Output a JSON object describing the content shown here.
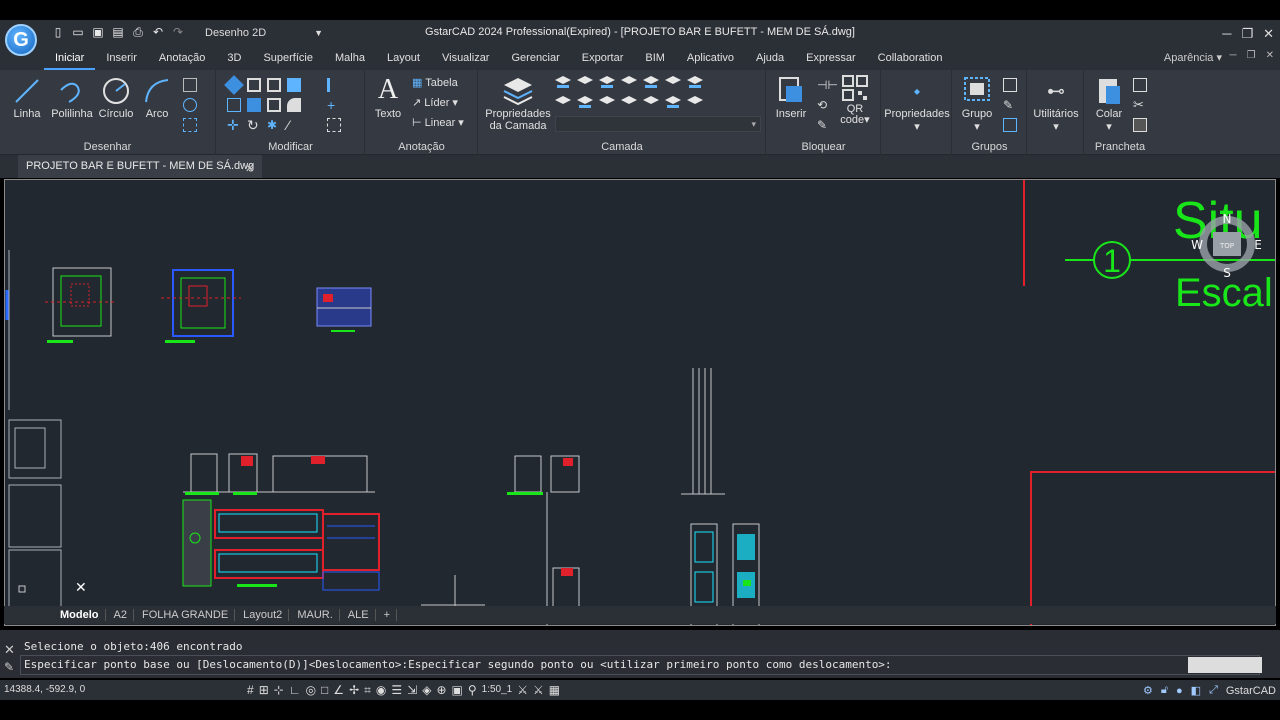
{
  "app": {
    "title": "GstarCAD 2024 Professional(Expired) - [PROJETO BAR E BUFETT - MEM DE SÁ.dwg]",
    "workspace": "Desenho 2D",
    "logo_letter": "G",
    "brand": "GstarCAD"
  },
  "menu": {
    "items": [
      "Iniciar",
      "Inserir",
      "Anotação",
      "3D",
      "Superfície",
      "Malha",
      "Layout",
      "Visualizar",
      "Gerenciar",
      "Exportar",
      "BIM",
      "Aplicativo",
      "Ajuda",
      "Expressar",
      "Collaboration"
    ],
    "active": "Iniciar",
    "aparencia": "Aparência"
  },
  "ribbon": {
    "desenhar": {
      "title": "Desenhar",
      "linha": "Linha",
      "polilinha": "Polilinha",
      "circulo": "Círculo",
      "arco": "Arco"
    },
    "modificar": {
      "title": "Modificar"
    },
    "anotacao": {
      "title": "Anotação",
      "texto": "Texto",
      "tabela": "Tabela",
      "lider": "Líder",
      "linear": "Linear"
    },
    "camada": {
      "title": "Camada",
      "propriedades": "Propriedades",
      "propriedades2": "da Camada"
    },
    "bloquear": {
      "title": "Bloquear",
      "inserir": "Inserir",
      "qr": "QR",
      "qr2": "code"
    },
    "propriedades": {
      "label": "Propriedades"
    },
    "grupos": {
      "title": "Grupos",
      "grupo": "Grupo"
    },
    "utilitarios": {
      "label": "Utilitários"
    },
    "prancheta": {
      "title": "Prancheta",
      "colar": "Colar"
    }
  },
  "document_tab": "PROJETO BAR E BUFETT - MEM DE SÁ.dwg",
  "drawing": {
    "bubble_number": "1",
    "title_big": "Situ",
    "title_sub": "Escal",
    "viewcube": {
      "top": "TOP",
      "n": "N",
      "s": "S",
      "e": "E",
      "w": "W"
    }
  },
  "layout_tabs": [
    "Modelo",
    "A2",
    "FOLHA GRANDE",
    "Layout2",
    "MAUR.",
    "ALE",
    "+"
  ],
  "command": {
    "line1": "Selecione o objeto:406 encontrado",
    "line2": "Especificar ponto base ou [Deslocamento(D)]<Deslocamento>:Especificar segundo ponto ou <utilizar primeiro ponto como deslocamento>:"
  },
  "status": {
    "coords": "14388.4, -592.9, 0",
    "scale": "1:50_1"
  },
  "colors": {
    "canvas": "#212830",
    "accent": "#4aa3ff",
    "green": "#19e619",
    "red": "#e0202a"
  }
}
